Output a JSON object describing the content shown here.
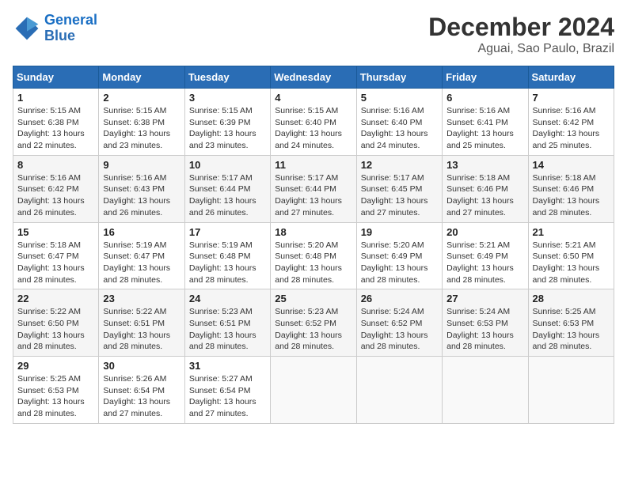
{
  "header": {
    "logo_line1": "General",
    "logo_line2": "Blue",
    "title": "December 2024",
    "subtitle": "Aguai, Sao Paulo, Brazil"
  },
  "calendar": {
    "weekdays": [
      "Sunday",
      "Monday",
      "Tuesday",
      "Wednesday",
      "Thursday",
      "Friday",
      "Saturday"
    ],
    "weeks": [
      [
        {
          "day": "1",
          "info": "Sunrise: 5:15 AM\nSunset: 6:38 PM\nDaylight: 13 hours\nand 22 minutes."
        },
        {
          "day": "2",
          "info": "Sunrise: 5:15 AM\nSunset: 6:38 PM\nDaylight: 13 hours\nand 23 minutes."
        },
        {
          "day": "3",
          "info": "Sunrise: 5:15 AM\nSunset: 6:39 PM\nDaylight: 13 hours\nand 23 minutes."
        },
        {
          "day": "4",
          "info": "Sunrise: 5:15 AM\nSunset: 6:40 PM\nDaylight: 13 hours\nand 24 minutes."
        },
        {
          "day": "5",
          "info": "Sunrise: 5:16 AM\nSunset: 6:40 PM\nDaylight: 13 hours\nand 24 minutes."
        },
        {
          "day": "6",
          "info": "Sunrise: 5:16 AM\nSunset: 6:41 PM\nDaylight: 13 hours\nand 25 minutes."
        },
        {
          "day": "7",
          "info": "Sunrise: 5:16 AM\nSunset: 6:42 PM\nDaylight: 13 hours\nand 25 minutes."
        }
      ],
      [
        {
          "day": "8",
          "info": "Sunrise: 5:16 AM\nSunset: 6:42 PM\nDaylight: 13 hours\nand 26 minutes."
        },
        {
          "day": "9",
          "info": "Sunrise: 5:16 AM\nSunset: 6:43 PM\nDaylight: 13 hours\nand 26 minutes."
        },
        {
          "day": "10",
          "info": "Sunrise: 5:17 AM\nSunset: 6:44 PM\nDaylight: 13 hours\nand 26 minutes."
        },
        {
          "day": "11",
          "info": "Sunrise: 5:17 AM\nSunset: 6:44 PM\nDaylight: 13 hours\nand 27 minutes."
        },
        {
          "day": "12",
          "info": "Sunrise: 5:17 AM\nSunset: 6:45 PM\nDaylight: 13 hours\nand 27 minutes."
        },
        {
          "day": "13",
          "info": "Sunrise: 5:18 AM\nSunset: 6:46 PM\nDaylight: 13 hours\nand 27 minutes."
        },
        {
          "day": "14",
          "info": "Sunrise: 5:18 AM\nSunset: 6:46 PM\nDaylight: 13 hours\nand 28 minutes."
        }
      ],
      [
        {
          "day": "15",
          "info": "Sunrise: 5:18 AM\nSunset: 6:47 PM\nDaylight: 13 hours\nand 28 minutes."
        },
        {
          "day": "16",
          "info": "Sunrise: 5:19 AM\nSunset: 6:47 PM\nDaylight: 13 hours\nand 28 minutes."
        },
        {
          "day": "17",
          "info": "Sunrise: 5:19 AM\nSunset: 6:48 PM\nDaylight: 13 hours\nand 28 minutes."
        },
        {
          "day": "18",
          "info": "Sunrise: 5:20 AM\nSunset: 6:48 PM\nDaylight: 13 hours\nand 28 minutes."
        },
        {
          "day": "19",
          "info": "Sunrise: 5:20 AM\nSunset: 6:49 PM\nDaylight: 13 hours\nand 28 minutes."
        },
        {
          "day": "20",
          "info": "Sunrise: 5:21 AM\nSunset: 6:49 PM\nDaylight: 13 hours\nand 28 minutes."
        },
        {
          "day": "21",
          "info": "Sunrise: 5:21 AM\nSunset: 6:50 PM\nDaylight: 13 hours\nand 28 minutes."
        }
      ],
      [
        {
          "day": "22",
          "info": "Sunrise: 5:22 AM\nSunset: 6:50 PM\nDaylight: 13 hours\nand 28 minutes."
        },
        {
          "day": "23",
          "info": "Sunrise: 5:22 AM\nSunset: 6:51 PM\nDaylight: 13 hours\nand 28 minutes."
        },
        {
          "day": "24",
          "info": "Sunrise: 5:23 AM\nSunset: 6:51 PM\nDaylight: 13 hours\nand 28 minutes."
        },
        {
          "day": "25",
          "info": "Sunrise: 5:23 AM\nSunset: 6:52 PM\nDaylight: 13 hours\nand 28 minutes."
        },
        {
          "day": "26",
          "info": "Sunrise: 5:24 AM\nSunset: 6:52 PM\nDaylight: 13 hours\nand 28 minutes."
        },
        {
          "day": "27",
          "info": "Sunrise: 5:24 AM\nSunset: 6:53 PM\nDaylight: 13 hours\nand 28 minutes."
        },
        {
          "day": "28",
          "info": "Sunrise: 5:25 AM\nSunset: 6:53 PM\nDaylight: 13 hours\nand 28 minutes."
        }
      ],
      [
        {
          "day": "29",
          "info": "Sunrise: 5:25 AM\nSunset: 6:53 PM\nDaylight: 13 hours\nand 28 minutes."
        },
        {
          "day": "30",
          "info": "Sunrise: 5:26 AM\nSunset: 6:54 PM\nDaylight: 13 hours\nand 27 minutes."
        },
        {
          "day": "31",
          "info": "Sunrise: 5:27 AM\nSunset: 6:54 PM\nDaylight: 13 hours\nand 27 minutes."
        },
        {
          "day": "",
          "info": ""
        },
        {
          "day": "",
          "info": ""
        },
        {
          "day": "",
          "info": ""
        },
        {
          "day": "",
          "info": ""
        }
      ]
    ]
  }
}
